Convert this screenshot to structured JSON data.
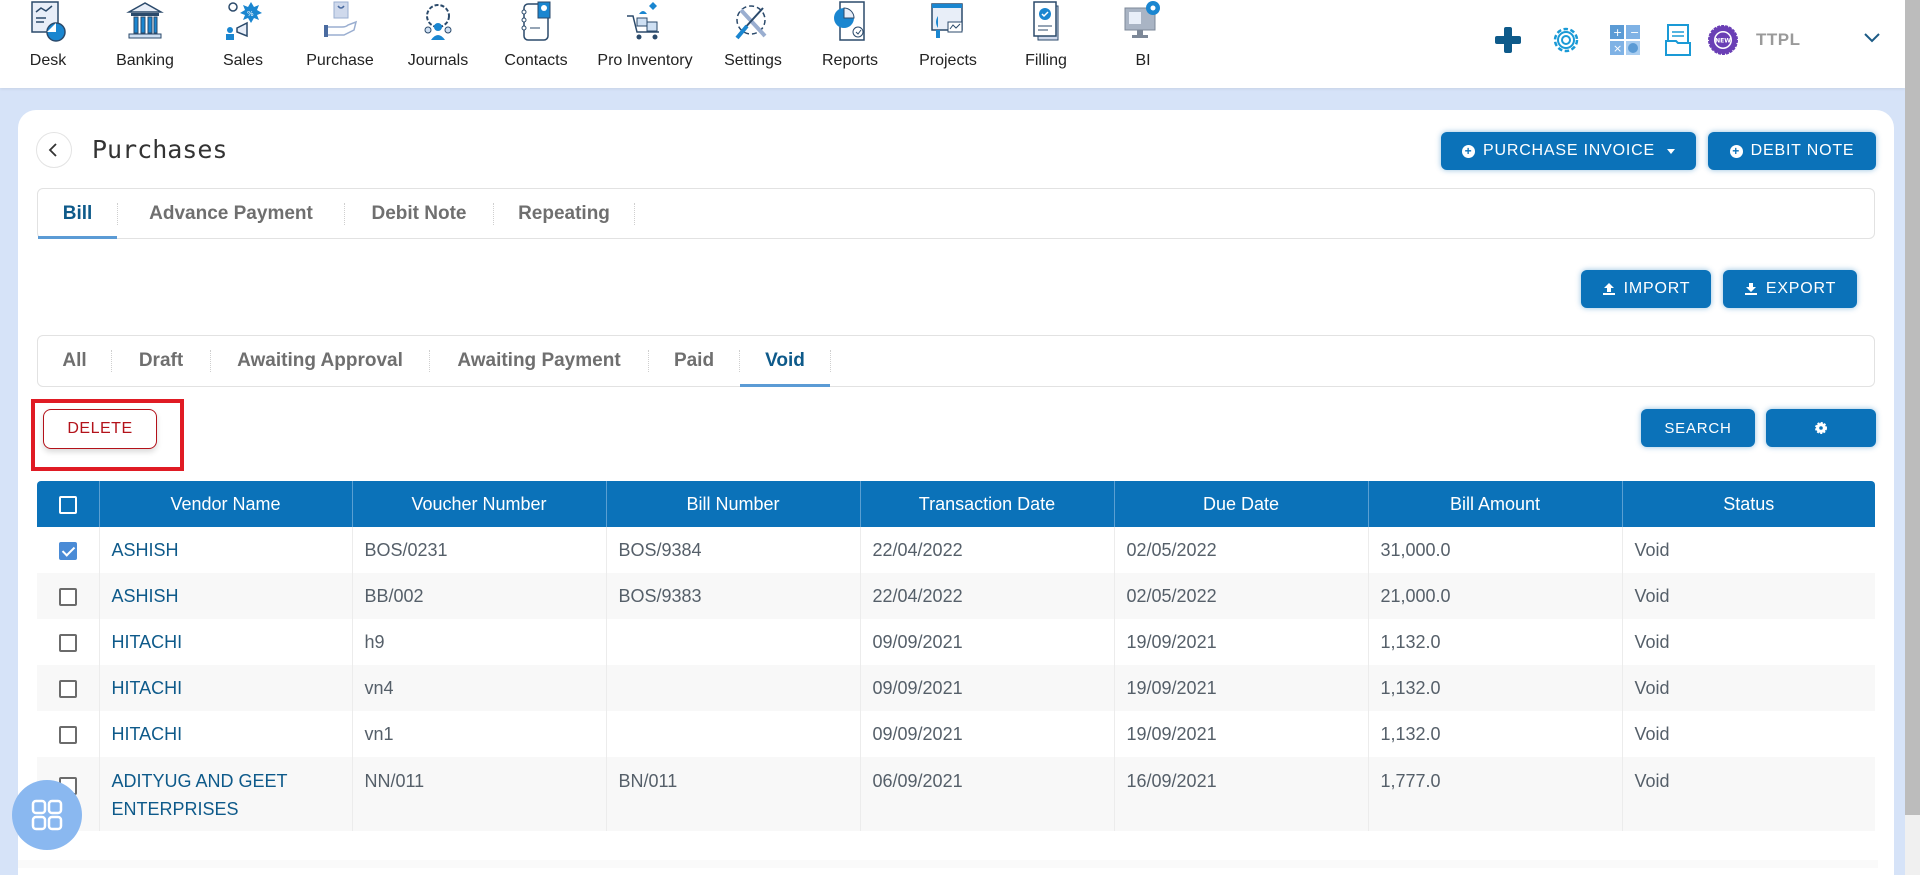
{
  "topnav": {
    "items": [
      {
        "label": "Desk",
        "icon": "desk-dashboard-icon"
      },
      {
        "label": "Banking",
        "icon": "bank-icon"
      },
      {
        "label": "Sales",
        "icon": "sales-megaphone-icon"
      },
      {
        "label": "Purchase",
        "icon": "purchase-bag-hand-icon"
      },
      {
        "label": "Journals",
        "icon": "journals-team-gear-icon"
      },
      {
        "label": "Contacts",
        "icon": "contacts-notebook-icon"
      },
      {
        "label": "Pro Inventory",
        "icon": "inventory-cart-icon"
      },
      {
        "label": "Settings",
        "icon": "settings-tools-icon"
      },
      {
        "label": "Reports",
        "icon": "reports-pie-chart-icon"
      },
      {
        "label": "Projects",
        "icon": "projects-board-icon"
      },
      {
        "label": "Filling",
        "icon": "filling-document-check-icon"
      },
      {
        "label": "BI",
        "icon": "bi-monitor-gear-icon"
      }
    ],
    "tools": {
      "add": "plus-icon",
      "settings": "gear-icon",
      "calculator": "calculator-icon",
      "documents": "documents-icon",
      "new_badge": "NEW"
    },
    "company": "TTPL"
  },
  "page": {
    "title": "Purchases",
    "buttons": {
      "purchase_invoice": "PURCHASE INVOICE",
      "debit_note": "DEBIT NOTE",
      "import": "IMPORT",
      "export": "EXPORT",
      "delete": "DELETE",
      "search": "SEARCH"
    },
    "main_tabs": [
      {
        "label": "Bill",
        "active": true
      },
      {
        "label": "Advance Payment",
        "active": false
      },
      {
        "label": "Debit Note",
        "active": false
      },
      {
        "label": "Repeating",
        "active": false
      }
    ],
    "status_tabs": [
      {
        "label": "All",
        "active": false
      },
      {
        "label": "Draft",
        "active": false
      },
      {
        "label": "Awaiting Approval",
        "active": false
      },
      {
        "label": "Awaiting Payment",
        "active": false
      },
      {
        "label": "Paid",
        "active": false
      },
      {
        "label": "Void",
        "active": true
      }
    ]
  },
  "table": {
    "columns": [
      "Vendor Name",
      "Voucher Number",
      "Bill Number",
      "Transaction Date",
      "Due Date",
      "Bill Amount",
      "Status"
    ],
    "rows": [
      {
        "checked": true,
        "vendor": "ASHISH",
        "voucher": "BOS/0231",
        "bill": "BOS/9384",
        "txn_date": "22/04/2022",
        "due_date": "02/05/2022",
        "amount": "31,000.0",
        "status": "Void"
      },
      {
        "checked": false,
        "vendor": "ASHISH",
        "voucher": "BB/002",
        "bill": "BOS/9383",
        "txn_date": "22/04/2022",
        "due_date": "02/05/2022",
        "amount": "21,000.0",
        "status": "Void"
      },
      {
        "checked": false,
        "vendor": "HITACHI",
        "voucher": "h9",
        "bill": "",
        "txn_date": "09/09/2021",
        "due_date": "19/09/2021",
        "amount": "1,132.0",
        "status": "Void"
      },
      {
        "checked": false,
        "vendor": "HITACHI",
        "voucher": "vn4",
        "bill": "",
        "txn_date": "09/09/2021",
        "due_date": "19/09/2021",
        "amount": "1,132.0",
        "status": "Void"
      },
      {
        "checked": false,
        "vendor": "HITACHI",
        "voucher": "vn1",
        "bill": "",
        "txn_date": "09/09/2021",
        "due_date": "19/09/2021",
        "amount": "1,132.0",
        "status": "Void"
      },
      {
        "checked": false,
        "vendor": "ADITYUG AND GEET ENTERPRISES",
        "voucher": "NN/011",
        "bill": "BN/011",
        "txn_date": "06/09/2021",
        "due_date": "16/09/2021",
        "amount": "1,777.0",
        "status": "Void"
      }
    ]
  },
  "colors": {
    "primary": "#0b72b9",
    "vendor_link": "#0e5a8a",
    "delete_red": "#b3121a",
    "highlight_red": "#e01b24",
    "page_bg": "#d6e3f8"
  }
}
